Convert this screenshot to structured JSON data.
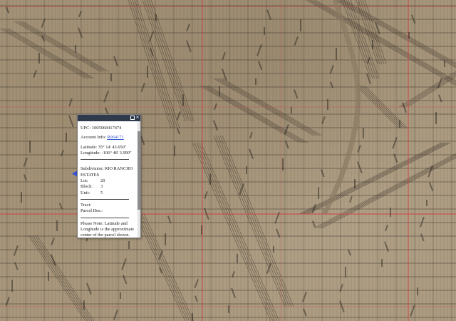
{
  "map": {
    "road_color": "#c94a4a",
    "parcel_line_color": "#3a322a",
    "imagery_color": "#a8977c"
  },
  "popup": {
    "upc": "UPC: 1005068417474",
    "account_label": "Account Info:",
    "account_value": "R064171",
    "latitude": "Latitude: 35° 14' 43.650\"",
    "longitude": "Longitude: -106° 48' 3.990\"",
    "subdivision_label": "Subdivision:",
    "subdivision_value": "RIO RANCHO ESTATES",
    "lot_label": "Lot:",
    "lot_value": "20",
    "block_label": "Block:",
    "block_value": "3",
    "unit_label": "Unit:",
    "unit_value": "5",
    "tract_label": "Tract:",
    "parcel_label": "Parcel Des.:",
    "note": "Please Note: Latitude and Longitude is the approximate center of the parcel shown."
  },
  "icons": {
    "maximize": "maximize-icon",
    "close": "close-icon",
    "pin": "location-pin-icon"
  }
}
